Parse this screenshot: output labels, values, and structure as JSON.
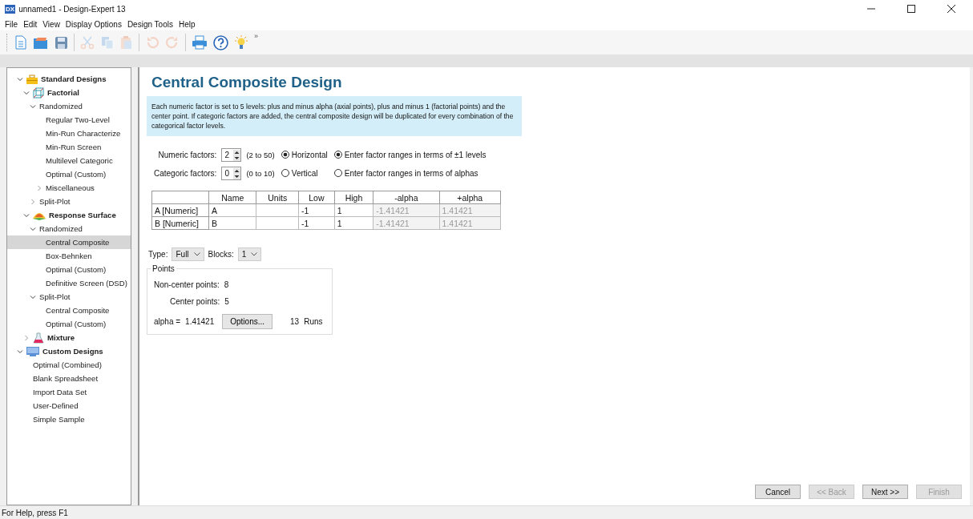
{
  "window": {
    "logo": "DX",
    "title": "unnamed1 - Design-Expert 13"
  },
  "menu": [
    "File",
    "Edit",
    "View",
    "Display Options",
    "Design Tools",
    "Help"
  ],
  "toolbar": {
    "buttons": [
      {
        "kind": "new",
        "disabled": false
      },
      {
        "kind": "open",
        "disabled": false
      },
      {
        "kind": "save",
        "disabled": false
      },
      {
        "kind": "sep"
      },
      {
        "kind": "cut",
        "disabled": true
      },
      {
        "kind": "copy",
        "disabled": true
      },
      {
        "kind": "paste",
        "disabled": true
      },
      {
        "kind": "sep"
      },
      {
        "kind": "undo",
        "disabled": true
      },
      {
        "kind": "redo",
        "disabled": true
      },
      {
        "kind": "sep"
      },
      {
        "kind": "print",
        "disabled": false
      },
      {
        "kind": "help",
        "disabled": false
      },
      {
        "kind": "tip",
        "disabled": false
      }
    ],
    "overflow": "»"
  },
  "tree": [
    {
      "label": "Standard Designs",
      "kind": "standard",
      "expanded": true,
      "selected": false,
      "children": [
        {
          "label": "Factorial",
          "kind": "factorial",
          "expanded": true,
          "selected": false,
          "children": [
            {
              "label": "Randomized",
              "kind": "item",
              "expanded": true,
              "selected": false,
              "children": [
                {
                  "label": "Regular Two-Level",
                  "kind": "item",
                  "selected": false
                },
                {
                  "label": "Min-Run Characterize",
                  "kind": "item",
                  "selected": false
                },
                {
                  "label": "Min-Run Screen",
                  "kind": "item",
                  "selected": false
                },
                {
                  "label": "Multilevel Categoric",
                  "kind": "item",
                  "selected": false
                },
                {
                  "label": "Optimal (Custom)",
                  "kind": "item",
                  "selected": false
                },
                {
                  "label": "Miscellaneous",
                  "kind": "item",
                  "expanded": false,
                  "selected": false
                }
              ]
            },
            {
              "label": "Split-Plot",
              "kind": "item",
              "expanded": false,
              "selected": false
            }
          ]
        },
        {
          "label": "Response Surface",
          "kind": "response-surface",
          "expanded": true,
          "selected": false,
          "children": [
            {
              "label": "Randomized",
              "kind": "item",
              "expanded": true,
              "selected": false,
              "children": [
                {
                  "label": "Central Composite",
                  "kind": "item",
                  "selected": true
                },
                {
                  "label": "Box-Behnken",
                  "kind": "item",
                  "selected": false
                },
                {
                  "label": "Optimal (Custom)",
                  "kind": "item",
                  "selected": false
                },
                {
                  "label": "Definitive Screen (DSD)",
                  "kind": "item",
                  "selected": false
                }
              ]
            },
            {
              "label": "Split-Plot",
              "kind": "item",
              "expanded": true,
              "selected": false,
              "children": [
                {
                  "label": "Central Composite",
                  "kind": "item",
                  "selected": false
                },
                {
                  "label": "Optimal (Custom)",
                  "kind": "item",
                  "selected": false
                }
              ]
            }
          ]
        },
        {
          "label": "Mixture",
          "kind": "mixture",
          "expanded": false,
          "selected": false
        }
      ]
    },
    {
      "label": "Custom Designs",
      "kind": "custom",
      "expanded": true,
      "selected": false,
      "children": [
        {
          "label": "Optimal (Combined)",
          "kind": "item",
          "selected": false
        },
        {
          "label": "Blank Spreadsheet",
          "kind": "item",
          "selected": false
        },
        {
          "label": "Import Data Set",
          "kind": "item",
          "selected": false
        },
        {
          "label": "User-Defined",
          "kind": "item",
          "selected": false
        },
        {
          "label": "Simple Sample",
          "kind": "item",
          "selected": false
        }
      ]
    }
  ],
  "page": {
    "title": "Central Composite Design",
    "info": "Each numeric factor is set to 5 levels: plus and minus alpha (axial points), plus and minus 1 (factorial points) and the center point. If categoric factors are added, the central composite design will be duplicated for every combination of the categorical factor levels.",
    "factors": [
      {
        "label": "Numeric factors:",
        "value": "2",
        "range": "(2 to 50)"
      },
      {
        "label": "Categoric factors:",
        "value": "0",
        "range": "(0 to 10)"
      }
    ],
    "orientation": [
      {
        "label": "Horizontal",
        "selected": true
      },
      {
        "label": "Vertical",
        "selected": false
      }
    ],
    "ranges": [
      {
        "label": "Enter factor ranges in terms of ±1 levels",
        "selected": true
      },
      {
        "label": "Enter factor ranges in terms of alphas",
        "selected": false
      }
    ],
    "table": {
      "columns": [
        {
          "label": "Name",
          "disabled": false
        },
        {
          "label": "Units",
          "disabled": false
        },
        {
          "label": "Low",
          "disabled": false
        },
        {
          "label": "High",
          "disabled": false
        },
        {
          "label": "-alpha",
          "disabled": true
        },
        {
          "label": "+alpha",
          "disabled": true
        }
      ],
      "rows": [
        {
          "header": "A [Numeric]",
          "cells": [
            "A",
            "",
            "-1",
            "1",
            "-1.41421",
            "1.41421"
          ]
        },
        {
          "header": "B [Numeric]",
          "cells": [
            "B",
            "",
            "-1",
            "1",
            "-1.41421",
            "1.41421"
          ]
        }
      ]
    },
    "type": {
      "label": "Type:",
      "value": "Full"
    },
    "blocks": {
      "label": "Blocks:",
      "value": "1"
    },
    "points": {
      "title": "Points",
      "noncenter_label": "Non-center points:",
      "noncenter": "8",
      "center_label": "Center points:",
      "center": "5",
      "alpha_label": "alpha =",
      "alpha": "1.41421",
      "options": "Options...",
      "runs": "13",
      "runs_label": "Runs"
    }
  },
  "buttons": [
    {
      "label": "Cancel",
      "disabled": false
    },
    {
      "label": "<< Back",
      "disabled": true
    },
    {
      "label": "Next >>",
      "disabled": false
    },
    {
      "label": "Finish",
      "disabled": true
    }
  ],
  "status_bar": "For Help, press F1"
}
